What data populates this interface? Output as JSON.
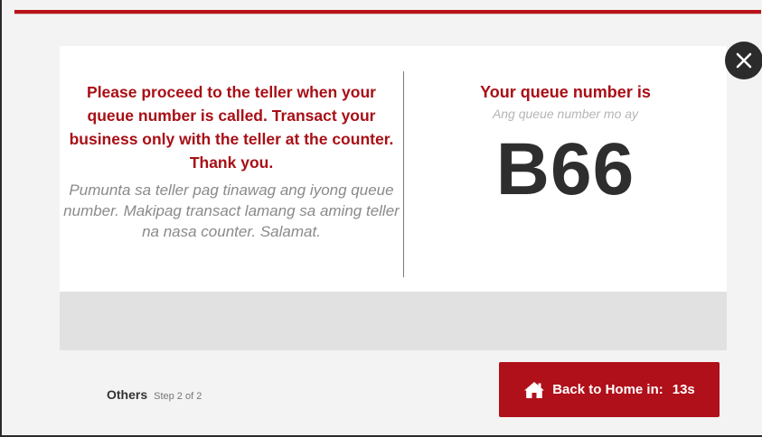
{
  "colors": {
    "accent_red": "#a80f16",
    "button_red": "#b0101a",
    "queue_number": "#2e2e2e",
    "close_bg": "#2b2b2b"
  },
  "left_panel": {
    "instruction_en": "Please proceed to the teller when your queue number is called. Transact your business only with the teller at the counter. Thank you.",
    "instruction_tl": "Pumunta sa teller pag tinawag ang iyong queue number. Makipag transact lamang sa aming teller na nasa counter. Salamat."
  },
  "right_panel": {
    "queue_label_en": "Your queue number is",
    "queue_label_tl": "Ang queue number mo ay",
    "queue_number": "B66"
  },
  "footer": {
    "step_title": "Others",
    "step_progress": "Step 2 of 2",
    "home_button_label": "Back to Home in:",
    "countdown": "13s"
  },
  "icons": {
    "close": "close-icon",
    "home": "home-icon"
  }
}
